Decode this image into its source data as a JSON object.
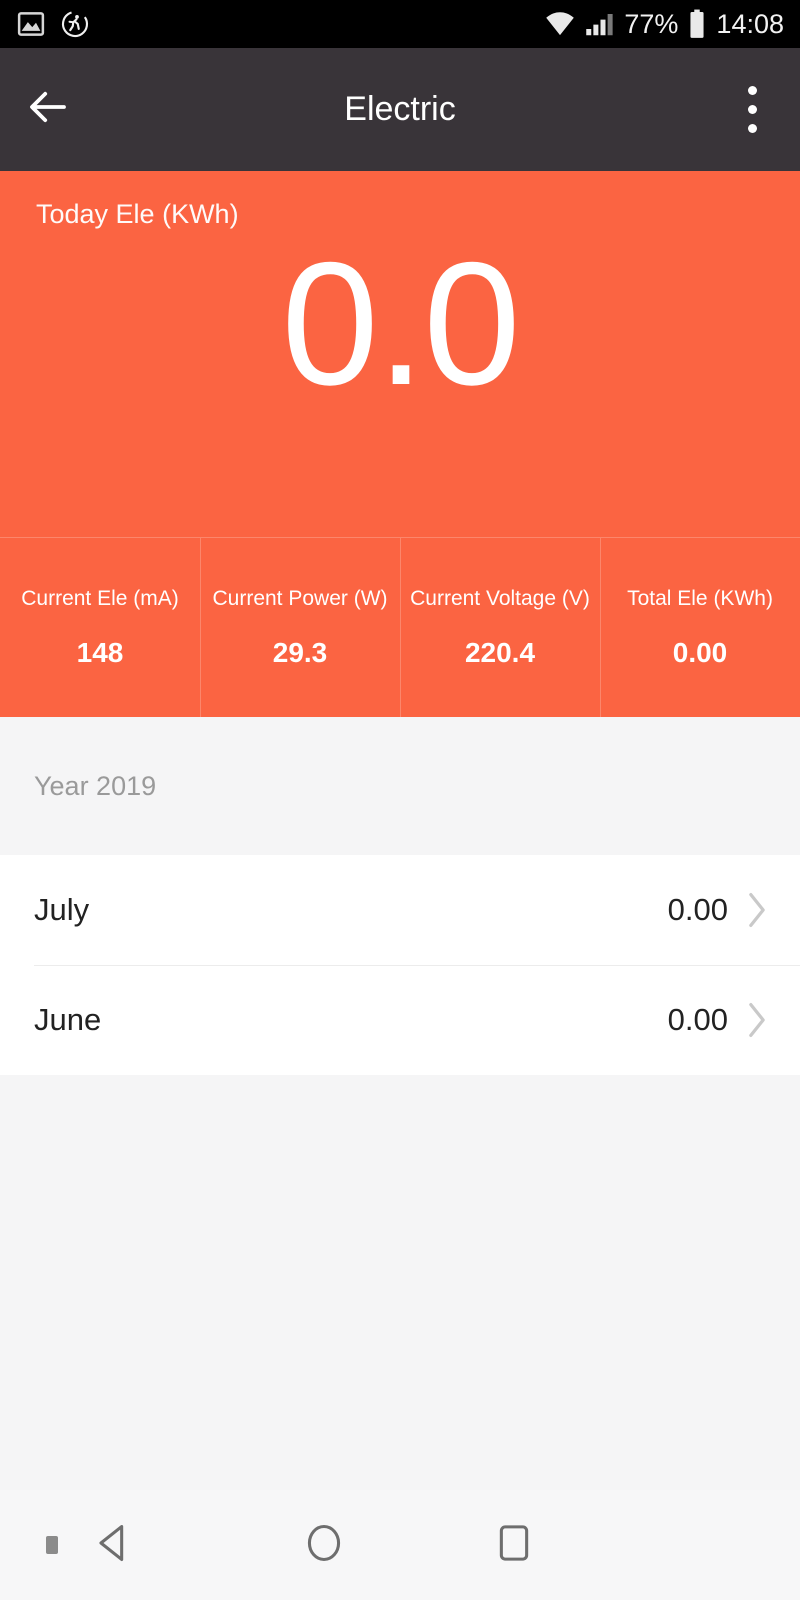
{
  "statusbar": {
    "icons_left": [
      "image-icon",
      "activity-running-icon"
    ],
    "wifi_icon": "wifi-icon",
    "signal_icon": "signal-bars-icon",
    "battery_percent": "77%",
    "battery_icon": "battery-icon",
    "clock": "14:08"
  },
  "appbar": {
    "back_icon": "back-arrow-icon",
    "title": "Electric",
    "menu_icon": "overflow-menu-icon"
  },
  "hero": {
    "label": "Today Ele (KWh)",
    "value": "0.0",
    "accent_color": "#FB6442"
  },
  "stats": [
    {
      "label": "Current Ele (mA)",
      "value": "148"
    },
    {
      "label": "Current Power (W)",
      "value": "29.3"
    },
    {
      "label": "Current Voltage (V)",
      "value": "220.4"
    },
    {
      "label": "Total Ele (KWh)",
      "value": "0.00"
    }
  ],
  "section": {
    "header": "Year 2019"
  },
  "list": [
    {
      "label": "July",
      "value": "0.00",
      "chevron": "chevron-right-icon"
    },
    {
      "label": "June",
      "value": "0.00",
      "chevron": "chevron-right-icon"
    }
  ],
  "navbar": {
    "dot": "nav-indicator-dot",
    "back": "nav-back-triangle-icon",
    "home": "nav-home-circle-icon",
    "recents": "nav-recents-square-icon"
  }
}
